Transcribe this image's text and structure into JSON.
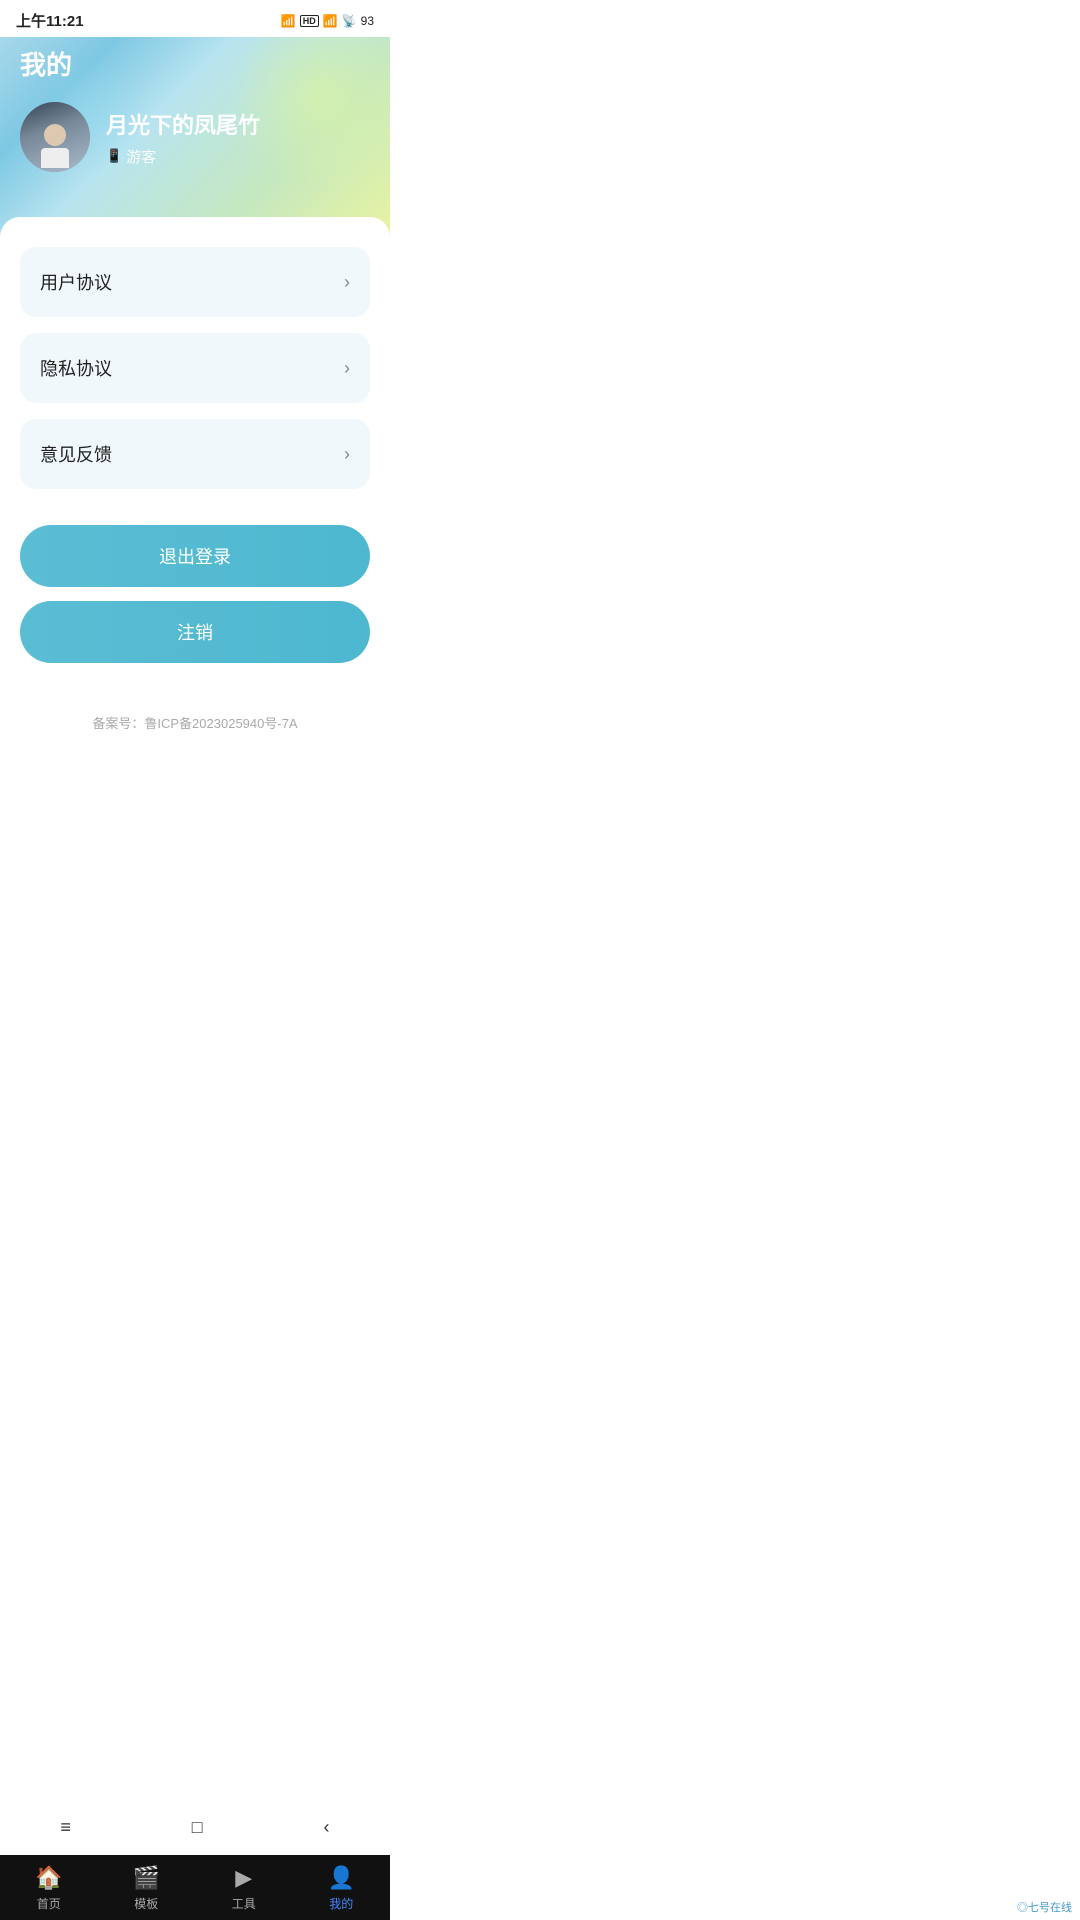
{
  "statusBar": {
    "time": "上午11:21",
    "battery": "93"
  },
  "hero": {
    "title": "我的",
    "profile": {
      "name": "月光下的凤尾竹",
      "role": "游客",
      "roleIcon": "📱"
    }
  },
  "menu": {
    "items": [
      {
        "id": "user-agreement",
        "label": "用户协议"
      },
      {
        "id": "privacy-policy",
        "label": "隐私协议"
      },
      {
        "id": "feedback",
        "label": "意见反馈"
      }
    ]
  },
  "buttons": {
    "logout": "退出登录",
    "cancel": "注销"
  },
  "icp": {
    "text": "备案号：鲁ICP备2023025940号-7A"
  },
  "bottomNav": {
    "items": [
      {
        "id": "home",
        "label": "首页",
        "icon": "🏠",
        "active": false
      },
      {
        "id": "template",
        "label": "模板",
        "icon": "🎬",
        "active": false
      },
      {
        "id": "tools",
        "label": "工具",
        "icon": "▶",
        "active": false
      },
      {
        "id": "mine",
        "label": "我的",
        "icon": "👤",
        "active": true
      }
    ]
  },
  "sysNav": {
    "menu": "≡",
    "home": "□",
    "back": "‹"
  },
  "watermark": "◎七号在线"
}
